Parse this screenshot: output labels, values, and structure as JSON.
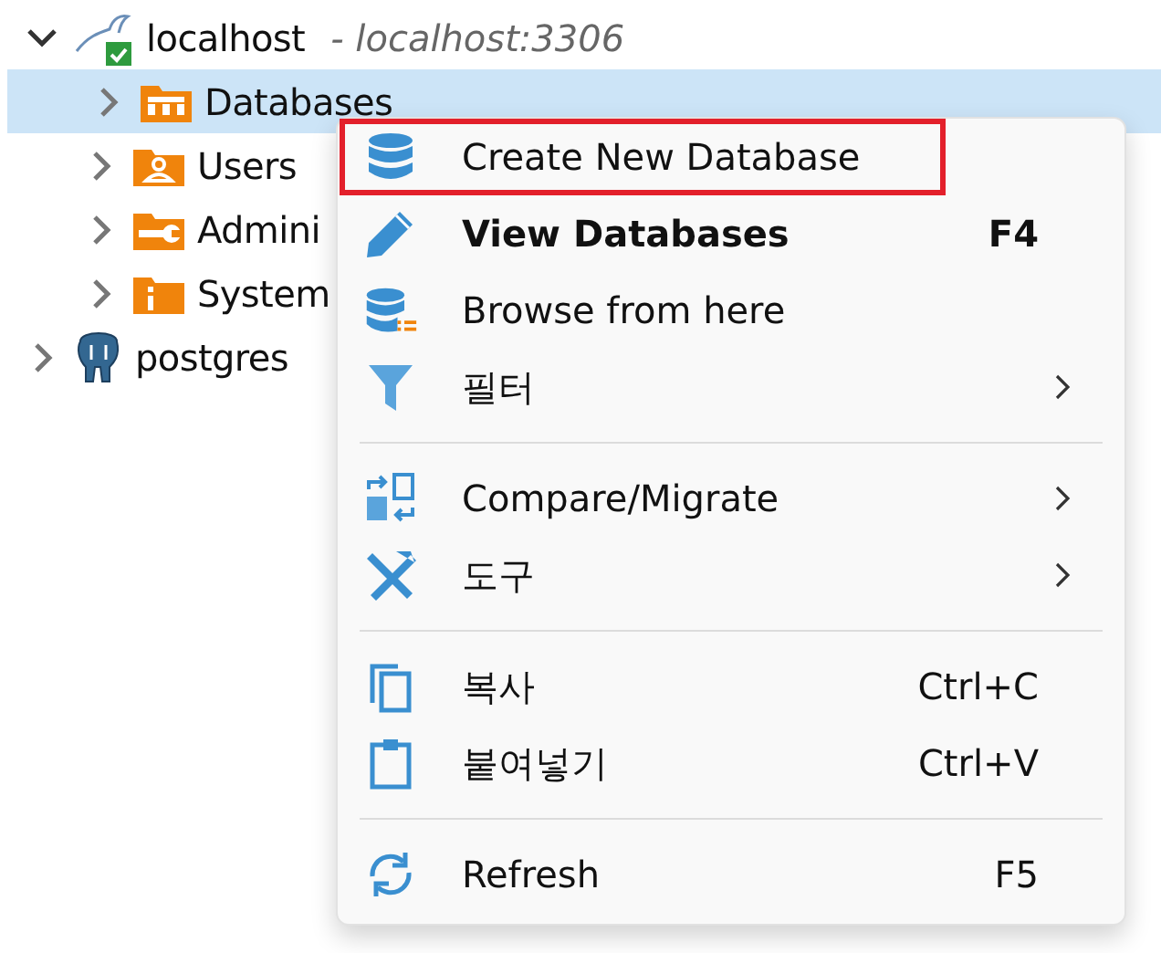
{
  "tree": [
    {
      "label": "localhost",
      "detail": "- localhost:3306",
      "expanded": true,
      "selected": false,
      "children": [
        {
          "label": "Databases",
          "expanded": false,
          "selected": true
        },
        {
          "label": "Users",
          "expanded": false,
          "selected": false
        },
        {
          "label": "Admini",
          "expanded": false,
          "selected": false
        },
        {
          "label": "System",
          "expanded": false,
          "selected": false
        }
      ]
    },
    {
      "label": "postgres",
      "expanded": false,
      "selected": false
    }
  ],
  "context_menu": [
    {
      "kind": "item",
      "label": "Create New Database",
      "highlighted": true,
      "bold": false
    },
    {
      "kind": "item",
      "label": "View Databases",
      "shortcut": "F4",
      "highlighted": false,
      "bold": true
    },
    {
      "kind": "item",
      "label": "Browse from here",
      "highlighted": false,
      "bold": false
    },
    {
      "kind": "item",
      "label": "필터",
      "submenu": true,
      "highlighted": false,
      "bold": false
    },
    {
      "kind": "separator"
    },
    {
      "kind": "item",
      "label": "Compare/Migrate",
      "submenu": true,
      "highlighted": false,
      "bold": false
    },
    {
      "kind": "item",
      "label": "도구",
      "submenu": true,
      "highlighted": false,
      "bold": false
    },
    {
      "kind": "separator"
    },
    {
      "kind": "item",
      "label": "복사",
      "shortcut": "Ctrl+C",
      "highlighted": false,
      "bold": false
    },
    {
      "kind": "item",
      "label": "붙여넣기",
      "shortcut": "Ctrl+V",
      "highlighted": false,
      "bold": false
    },
    {
      "kind": "separator"
    },
    {
      "kind": "item",
      "label": "Refresh",
      "shortcut": "F5",
      "highlighted": false,
      "bold": false
    }
  ]
}
